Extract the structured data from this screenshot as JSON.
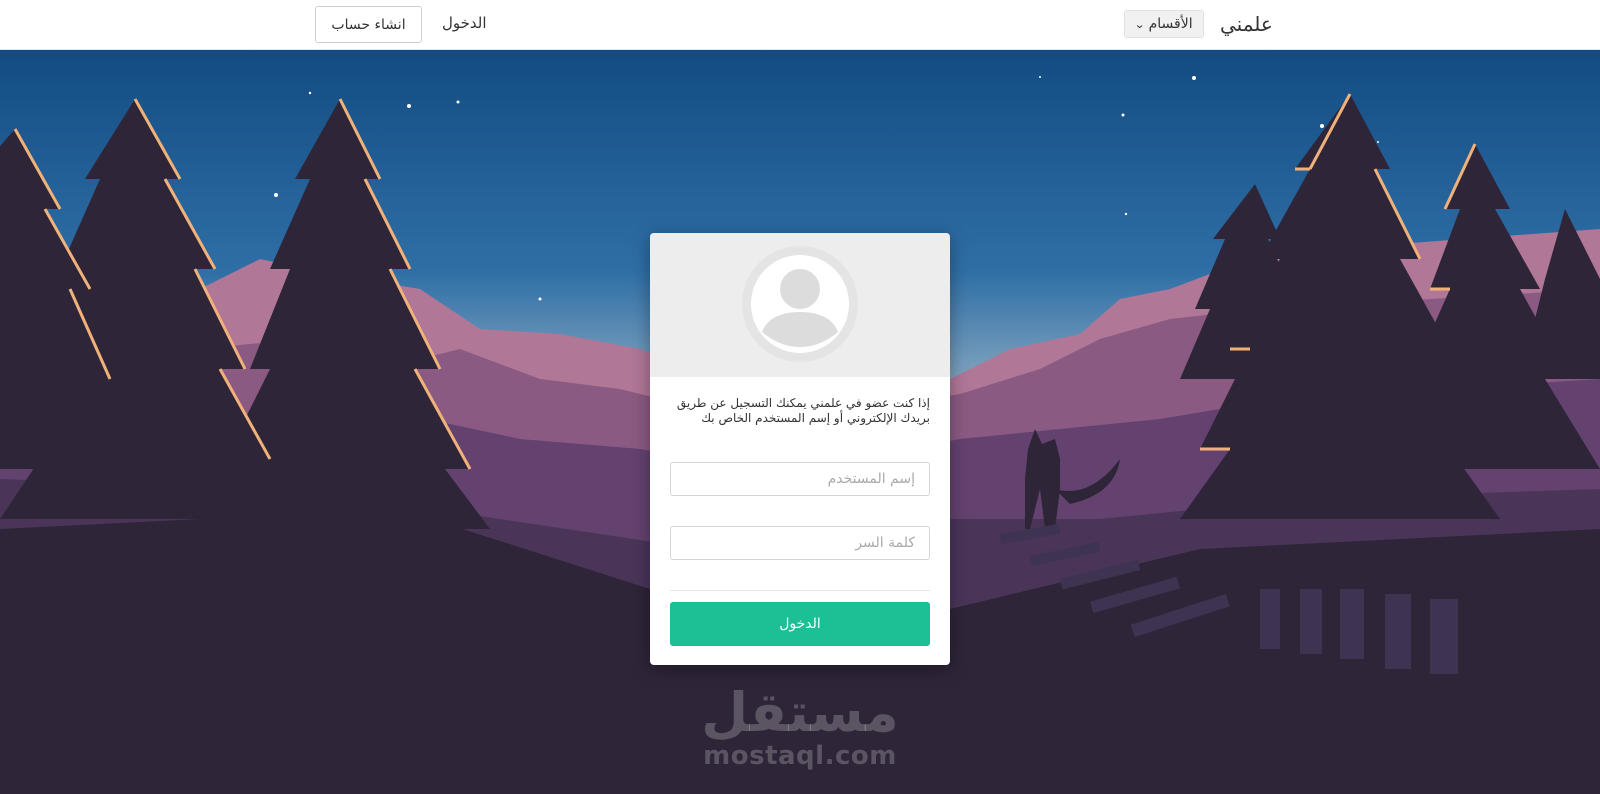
{
  "navbar": {
    "brand": "علمني",
    "sections_label": "الأقسام",
    "login_label": "الدخول",
    "signup_label": "انشاء حساب"
  },
  "login_card": {
    "intro_text": "إذا كنت عضو في علمني يمكنك التسجيل عن طريق بريدك الإلكتروني أو إسم المستخدم الخاص بك",
    "username_placeholder": "إسم المستخدم",
    "password_placeholder": "كلمة السر",
    "submit_label": "الدخول",
    "accent_color": "#1dbf95"
  },
  "watermark": {
    "arabic": "مستقل",
    "latin": "mostaql.com"
  }
}
